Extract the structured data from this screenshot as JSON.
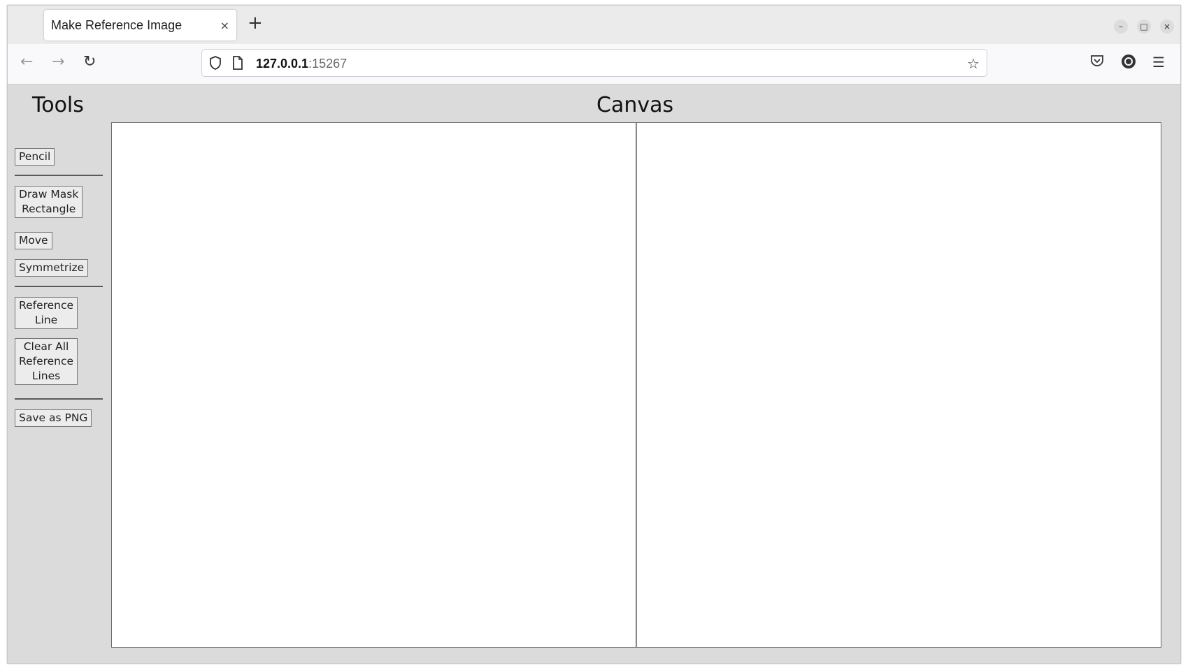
{
  "browser": {
    "tab_title": "Make Reference Image",
    "tab_close": "×",
    "new_tab": "+",
    "url_host": "127.0.0.1",
    "url_port": ":15267",
    "window_controls": {
      "minimize": "–",
      "maximize": "□",
      "close": "×"
    },
    "icons": [
      "back-arrow-icon",
      "forward-arrow-icon",
      "reload-icon",
      "shield-icon",
      "page-icon",
      "star-icon",
      "pocket-icon",
      "account-icon",
      "hamburger-menu-icon"
    ]
  },
  "page": {
    "tools_title": "Tools",
    "canvas_title": "Canvas",
    "buttons": {
      "pencil": "Pencil",
      "draw_mask_rectangle": "Draw Mask\nRectangle",
      "move": "Move",
      "symmetrize": "Symmetrize",
      "reference_line": "Reference\nLine",
      "clear_all_reference_lines": "Clear All\nReference\nLines",
      "save_as_png": "Save as PNG"
    }
  }
}
